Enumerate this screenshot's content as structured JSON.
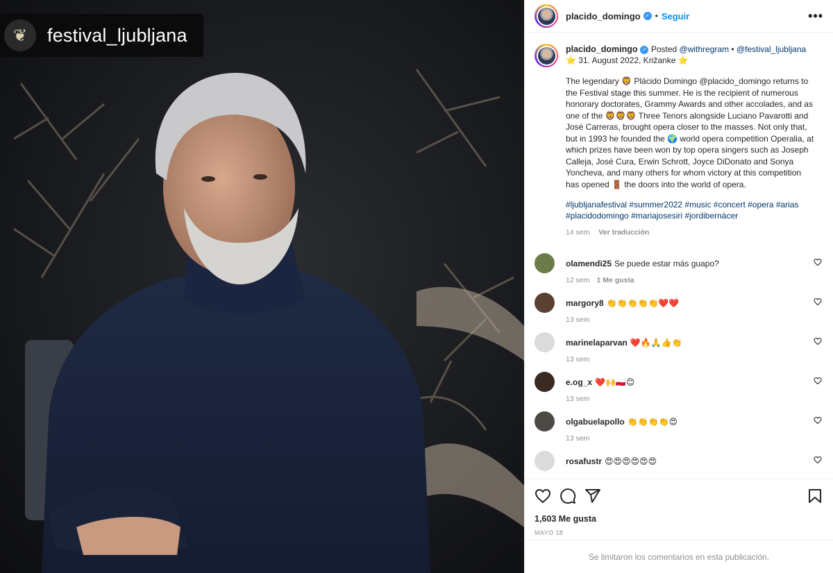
{
  "repost": {
    "name": "festival_ljubljana"
  },
  "header": {
    "username": "placido_domingo",
    "follow_label": "Seguir",
    "more": "•••"
  },
  "caption": {
    "username": "placido_domingo",
    "posted": "Posted",
    "via": "@withregram",
    "separator": "•",
    "tag": "@festival_ljubljana",
    "date_line": "⭐ 31. August 2022, Križanke ⭐",
    "text": "The legendary 🦁 Plácido Domingo @placido_domingo returns to the Festival stage this summer. He is the recipient of numerous honorary doctorates, Grammy Awards and other accolades, and as one of the 🦁🦁🦁 Three Tenors alongside Luciano Pavarotti and José Carreras, brought opera closer to the masses. Not only that, but in 1993 he founded the 🌍 world opera competition Operalia, at which prizes have been won by top opera singers such as Joseph Calleja, José Cura, Erwin Schrott, Joyce DiDonato and Sonya Yoncheva, and many others for whom victory at this competition has opened 🚪 the doors into the world of opera.",
    "hashtags": "#ljubljanafestival #summer2022 #music #concert #opera #arias #placidodomingo #mariajosesiri #jordibernàcer",
    "age": "14 sem",
    "translate": "Ver traducción"
  },
  "comments": [
    {
      "user": "olamendi25",
      "text": "Se puede estar más guapo?",
      "age": "12 sem",
      "likes": "1 Me gusta",
      "avatar_color": "#6b7c4a"
    },
    {
      "user": "margory8",
      "text": "👏👏👏👏👏❤️❤️",
      "age": "13 sem",
      "likes": "",
      "avatar_color": "#5a4030"
    },
    {
      "user": "marinelaparvan",
      "text": "❤️🔥🙏👍👏",
      "age": "13 sem",
      "likes": "",
      "avatar_color": "#dbdbdb"
    },
    {
      "user": "e.og_x",
      "text": "❤️🙌🇵🇱😊",
      "age": "13 sem",
      "likes": "",
      "avatar_color": "#3a2a22"
    },
    {
      "user": "olgabuelapollo",
      "text": "👏👏👏👏😍",
      "age": "13 sem",
      "likes": "",
      "avatar_color": "#4d4a45"
    },
    {
      "user": "rosafustr",
      "text": "😍😍😍😍😍😍",
      "age": "",
      "likes": "",
      "avatar_color": "#dbdbdb"
    }
  ],
  "footer": {
    "likes": "1,603 Me gusta",
    "date": "MAYO 18",
    "limited": "Se limitaron los comentarios en esta publicación."
  },
  "colors": {
    "link": "#00376b",
    "follow": "#0095f6",
    "muted": "#8e8e8e",
    "heart": "#ed4956"
  }
}
